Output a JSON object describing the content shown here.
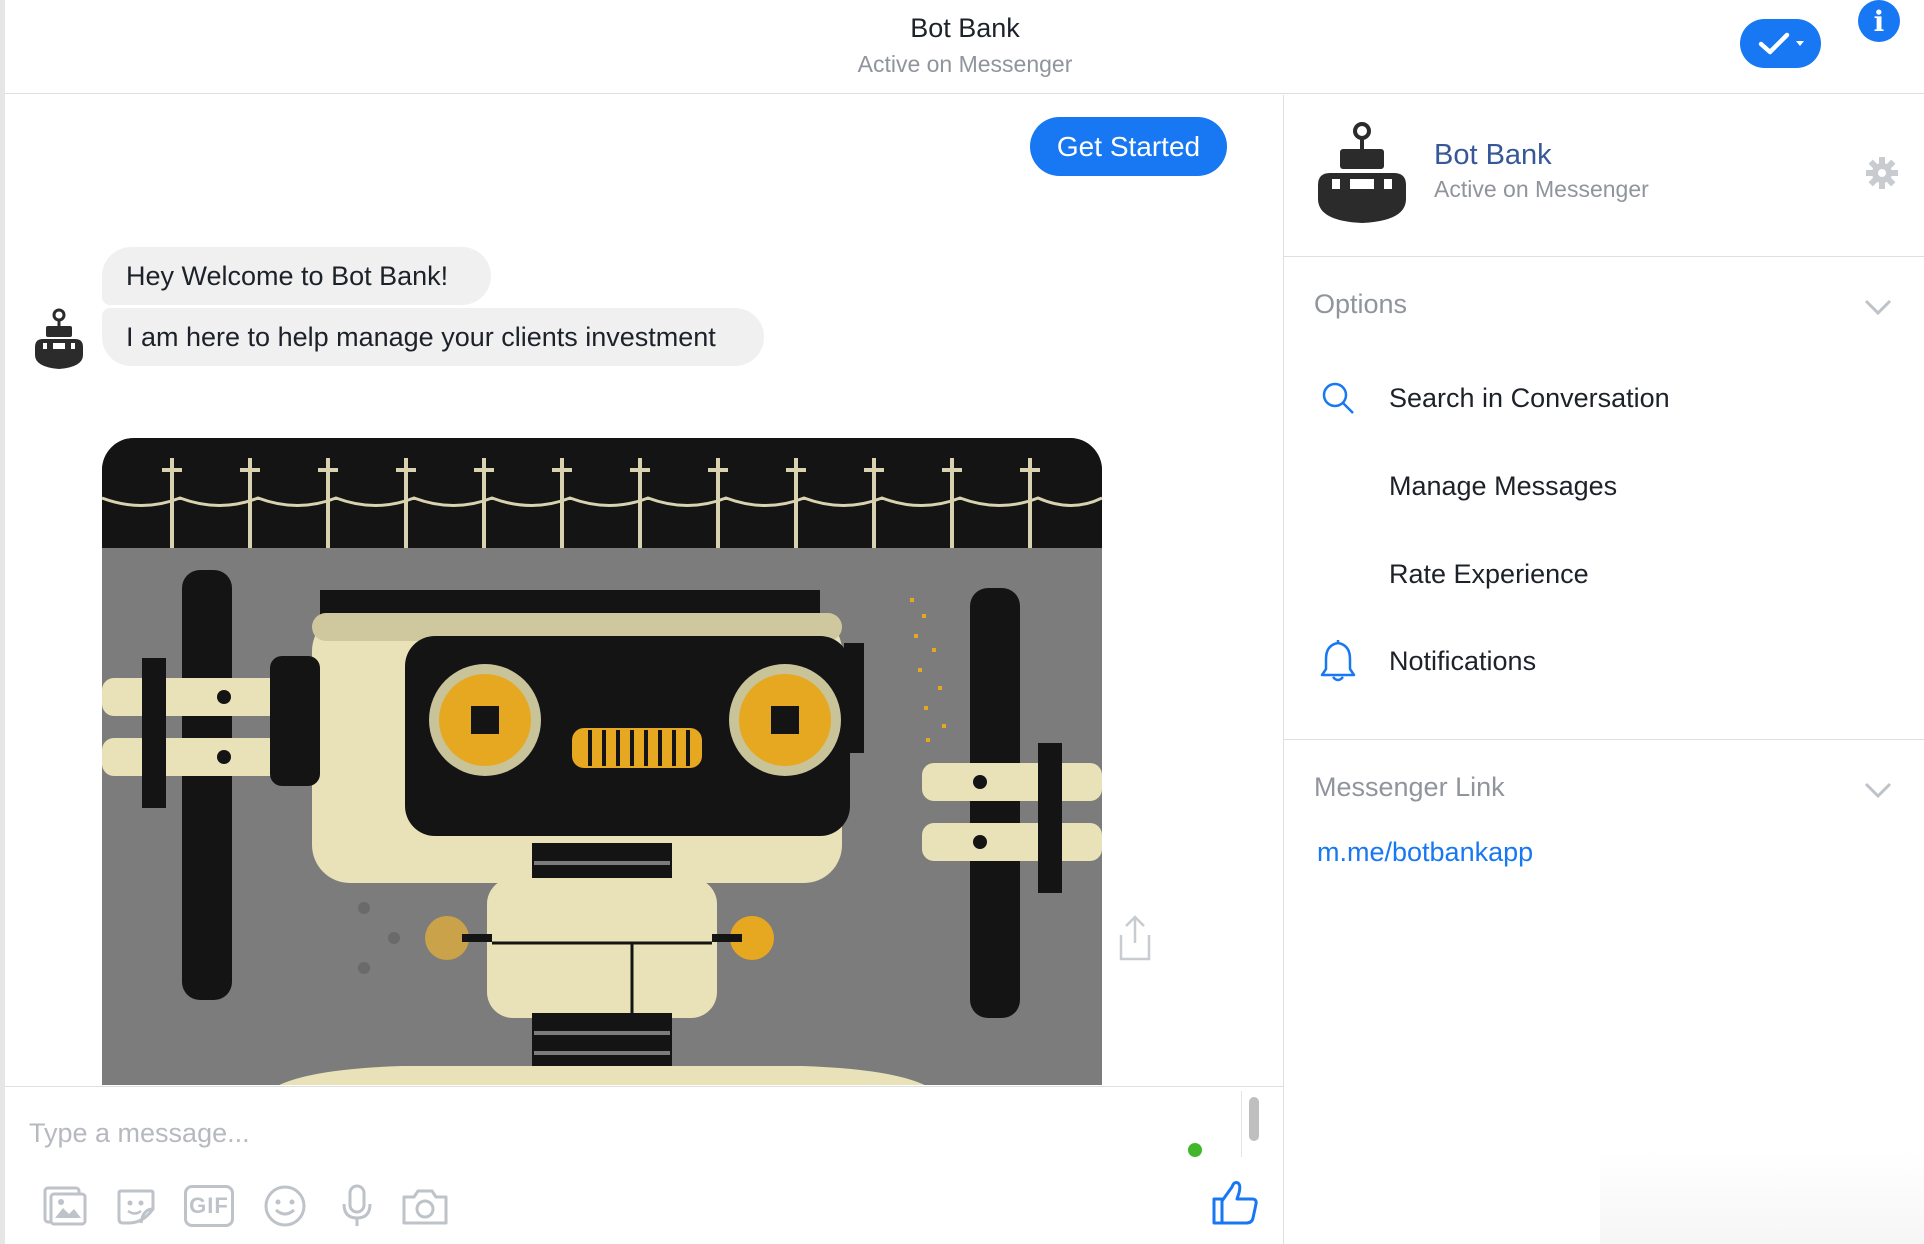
{
  "header": {
    "title": "Bot Bank",
    "subtitle": "Active on Messenger"
  },
  "chat": {
    "get_started": "Get Started",
    "messages": [
      "Hey Welcome to Bot Bank!",
      "I am here to help manage your clients investment"
    ]
  },
  "composer": {
    "placeholder": "Type a message...",
    "gif_label": "GIF"
  },
  "panel": {
    "name": "Bot Bank",
    "status": "Active on Messenger",
    "options_title": "Options",
    "options": [
      {
        "label": "Search in Conversation",
        "icon": "search-icon"
      },
      {
        "label": "Manage Messages",
        "icon": ""
      },
      {
        "label": "Rate Experience",
        "icon": ""
      },
      {
        "label": "Notifications",
        "icon": "bell-icon"
      }
    ],
    "link_title": "Messenger Link",
    "link": "m.me/botbankapp"
  },
  "colors": {
    "brand_blue": "#1877f2",
    "link_blue": "#365899",
    "bubble_grey": "#f1f0f0",
    "muted_text": "#90949c"
  }
}
